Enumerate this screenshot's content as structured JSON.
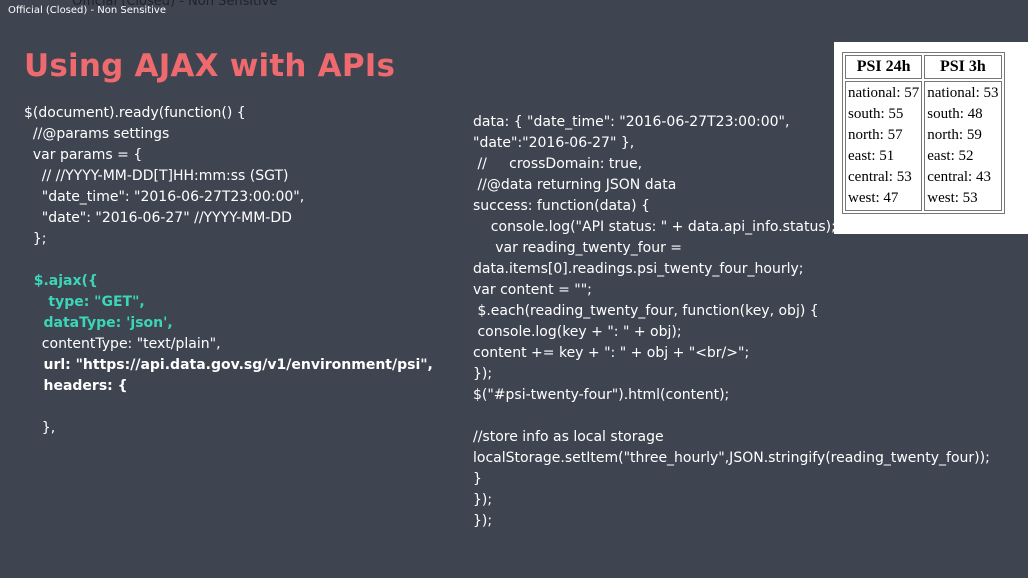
{
  "top_label": "Official (Closed) - Non Sensitive",
  "top_label_shadow": "Official (Closed) - Non Sensitive",
  "title": "Using AJAX with APIs",
  "left_code": [
    {
      "text": "$(document).ready(function() {",
      "style": ""
    },
    {
      "text": "  //@params settings",
      "style": ""
    },
    {
      "text": "  var params = {",
      "style": ""
    },
    {
      "text": "    // //YYYY-MM-DD[T]HH:mm:ss (SGT)",
      "style": ""
    },
    {
      "text": "    \"date_time\": \"2016-06-27T23:00:00\",",
      "style": ""
    },
    {
      "text": "    \"date\": \"2016-06-27\" //YYYY-MM-DD",
      "style": ""
    },
    {
      "text": "  };",
      "style": ""
    },
    {
      "text": "",
      "style": ""
    },
    {
      "text": "  $.ajax({",
      "style": "cyan"
    },
    {
      "text": "     type: \"GET\",",
      "style": "cyan"
    },
    {
      "text": "    dataType: 'json',",
      "style": "cyan"
    },
    {
      "text": "    contentType: \"text/plain\",",
      "style": ""
    },
    {
      "text": "    url: \"https://api.data.gov.sg/v1/environment/psi\",",
      "style": "bold"
    },
    {
      "text": "    headers: {",
      "style": "bold"
    },
    {
      "text": "",
      "style": ""
    },
    {
      "text": "    },",
      "style": ""
    }
  ],
  "right_code": [
    {
      "text": "data: { \"date_time\": \"2016-06-27T23:00:00\",",
      "style": ""
    },
    {
      "text": "\"date\":\"2016-06-27\" },",
      "style": ""
    },
    {
      "text": " //     crossDomain: true,",
      "style": ""
    },
    {
      "text": " //@data returning JSON data",
      "style": ""
    },
    {
      "text": "success: function(data) {",
      "style": ""
    },
    {
      "text": "    console.log(\"API status: \" + data.api_info.status);",
      "style": ""
    },
    {
      "text": "     var reading_twenty_four =",
      "style": ""
    },
    {
      "text": "data.items[0].readings.psi_twenty_four_hourly;",
      "style": ""
    },
    {
      "text": "var content = \"\";",
      "style": ""
    },
    {
      "text": " $.each(reading_twenty_four, function(key, obj) {",
      "style": ""
    },
    {
      "text": " console.log(key + \": \" + obj);",
      "style": ""
    },
    {
      "text": "content += key + \": \" + obj + \"<br/>\";",
      "style": ""
    },
    {
      "text": "});",
      "style": ""
    },
    {
      "text": "$(\"#psi-twenty-four\").html(content);",
      "style": ""
    },
    {
      "text": "",
      "style": ""
    },
    {
      "text": "//store info as local storage",
      "style": ""
    },
    {
      "text": "localStorage.setItem(\"three_hourly\",JSON.stringify(reading_twenty_four));",
      "style": ""
    },
    {
      "text": "}",
      "style": ""
    },
    {
      "text": "});",
      "style": ""
    },
    {
      "text": "});",
      "style": ""
    }
  ],
  "psi_table": {
    "headers": [
      "PSI 24h",
      "PSI 3h"
    ],
    "columns": [
      [
        "national: 57",
        "south: 55",
        "north: 57",
        "east: 51",
        "central: 53",
        "west: 47"
      ],
      [
        "national: 53",
        "south: 48",
        "north: 59",
        "east: 52",
        "central: 43",
        "west: 53"
      ]
    ]
  },
  "colors": {
    "background": "#3f4451",
    "title": "#ee6a6e",
    "accent_code": "#3bd6b8"
  }
}
